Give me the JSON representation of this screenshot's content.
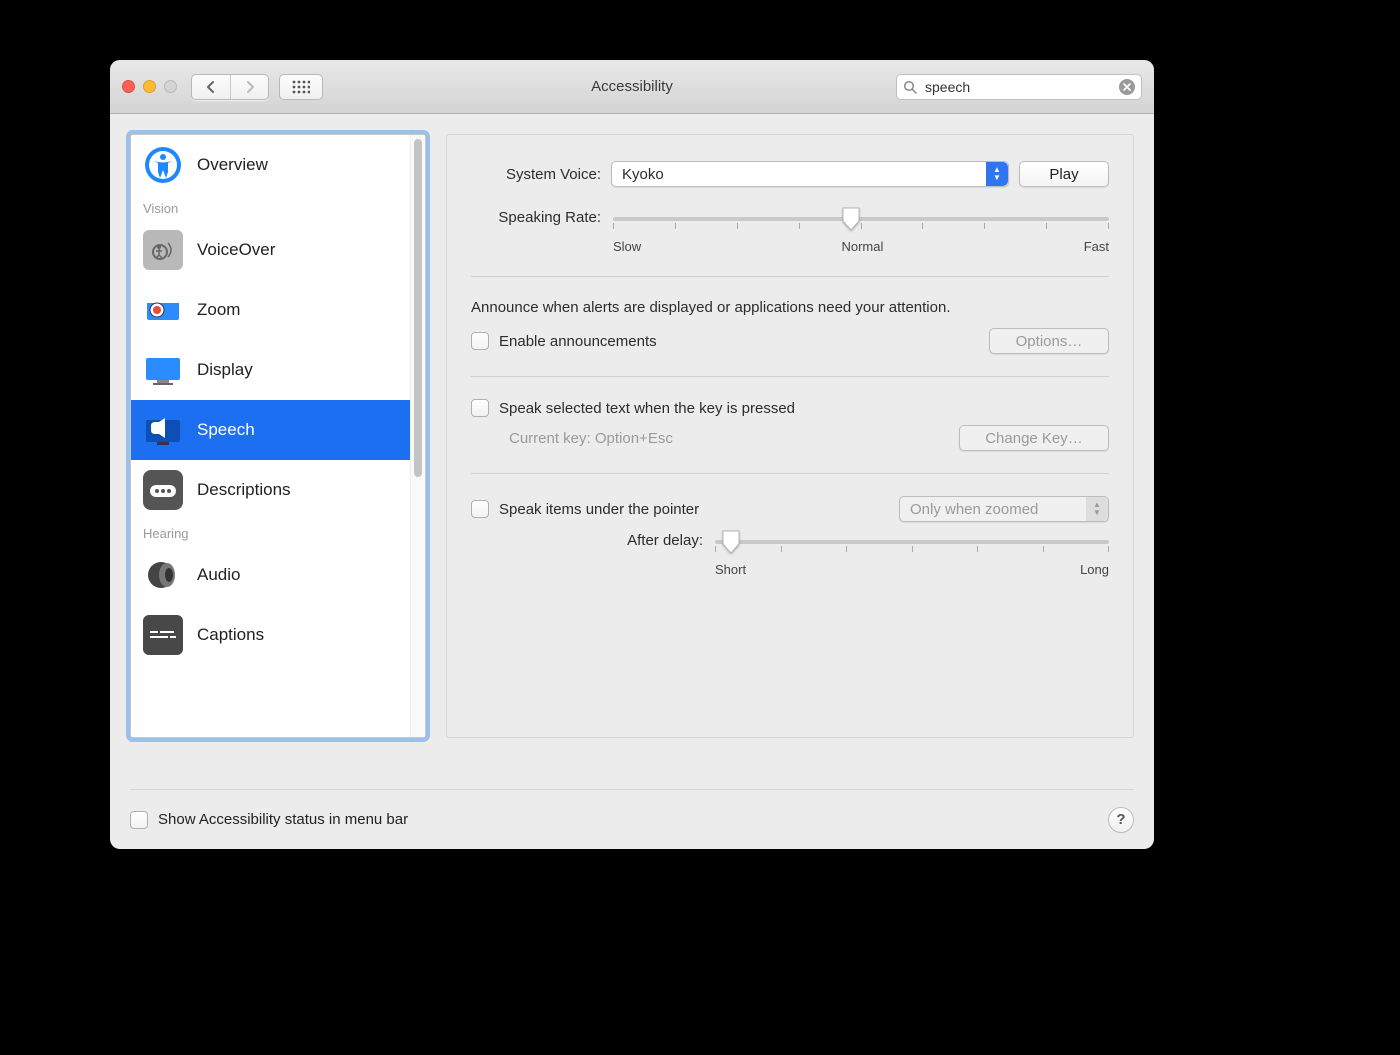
{
  "window": {
    "title": "Accessibility",
    "search_value": "speech"
  },
  "sidebar": {
    "items": [
      {
        "label": "Overview"
      },
      {
        "label": "VoiceOver"
      },
      {
        "label": "Zoom"
      },
      {
        "label": "Display"
      },
      {
        "label": "Speech"
      },
      {
        "label": "Descriptions"
      },
      {
        "label": "Audio"
      },
      {
        "label": "Captions"
      }
    ],
    "categories": {
      "vision": "Vision",
      "hearing": "Hearing"
    }
  },
  "main": {
    "system_voice_label": "System Voice:",
    "system_voice_value": "Kyoko",
    "play_label": "Play",
    "speaking_rate_label": "Speaking Rate:",
    "rate_slow": "Slow",
    "rate_normal": "Normal",
    "rate_fast": "Fast",
    "announce_text": "Announce when alerts are displayed or applications need your attention.",
    "enable_announcements": "Enable announcements",
    "options_label": "Options…",
    "speak_selected_label": "Speak selected text when the key is pressed",
    "current_key_label": "Current key: Option+Esc",
    "change_key_label": "Change Key…",
    "speak_pointer_label": "Speak items under the pointer",
    "zoom_mode_label": "Only when zoomed",
    "after_delay_label": "After delay:",
    "delay_short": "Short",
    "delay_long": "Long"
  },
  "footer": {
    "show_status_label": "Show Accessibility status in menu bar"
  }
}
